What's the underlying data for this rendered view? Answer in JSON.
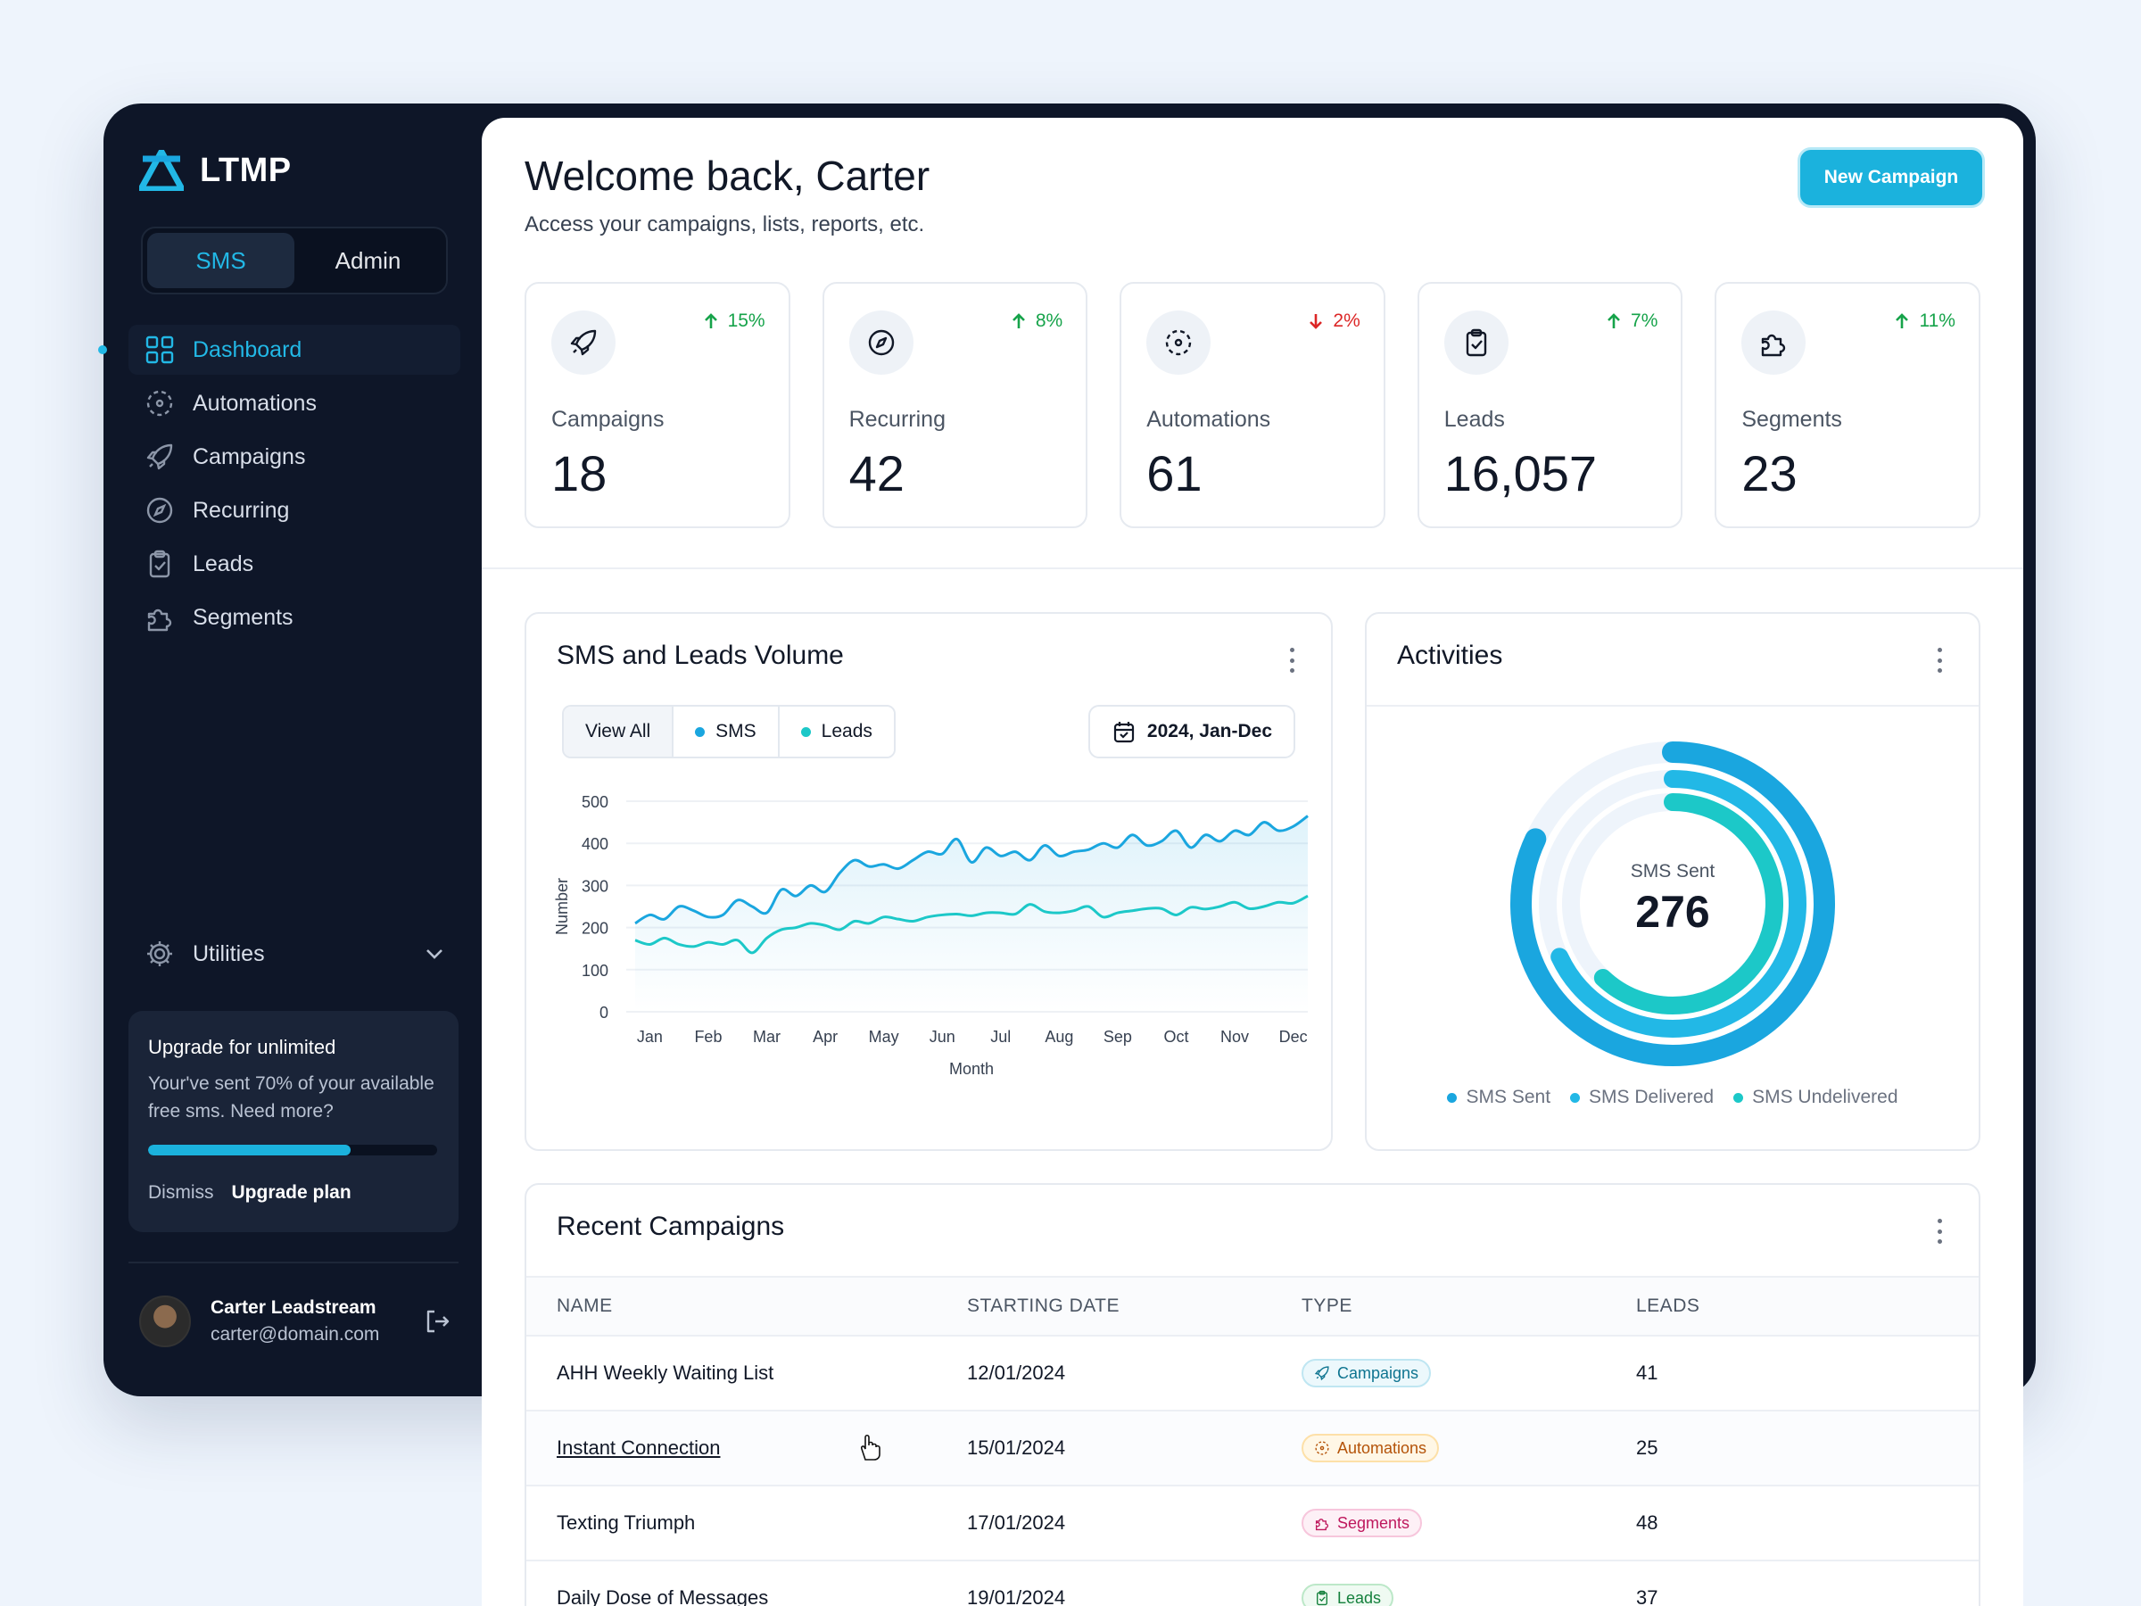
{
  "app": {
    "name": "LTMP"
  },
  "switcher": {
    "options": [
      "SMS",
      "Admin"
    ],
    "active": "SMS"
  },
  "nav": {
    "items": [
      {
        "label": "Dashboard",
        "icon": "grid-icon",
        "active": true
      },
      {
        "label": "Automations",
        "icon": "automation-icon"
      },
      {
        "label": "Campaigns",
        "icon": "rocket-icon"
      },
      {
        "label": "Recurring",
        "icon": "compass-icon"
      },
      {
        "label": "Leads",
        "icon": "clipboard-check-icon"
      },
      {
        "label": "Segments",
        "icon": "puzzle-icon"
      }
    ],
    "utilities": "Utilities"
  },
  "upgrade": {
    "title": "Upgrade for unlimited",
    "text": "Your've sent 70% of your available free sms. Need more?",
    "progress": 0.7,
    "dismiss": "Dismiss",
    "plan": "Upgrade plan"
  },
  "user": {
    "name": "Carter Leadstream",
    "email": "carter@domain.com"
  },
  "header": {
    "title": "Welcome back, Carter",
    "subtitle": "Access your campaigns, lists, reports, etc.",
    "new_campaign": "New Campaign"
  },
  "stats": [
    {
      "label": "Campaigns",
      "value": "18",
      "trend": "15%",
      "direction": "up",
      "icon": "rocket-icon"
    },
    {
      "label": "Recurring",
      "value": "42",
      "trend": "8%",
      "direction": "up",
      "icon": "compass-icon"
    },
    {
      "label": "Automations",
      "value": "61",
      "trend": "2%",
      "direction": "down",
      "icon": "automation-icon"
    },
    {
      "label": "Leads",
      "value": "16,057",
      "trend": "7%",
      "direction": "up",
      "icon": "clipboard-check-icon"
    },
    {
      "label": "Segments",
      "value": "23",
      "trend": "11%",
      "direction": "up",
      "icon": "puzzle-icon"
    }
  ],
  "volume_card": {
    "title": "SMS and Leads Volume",
    "filters": [
      "View All",
      "SMS",
      "Leads"
    ],
    "date_range": "2024, Jan-Dec"
  },
  "chart_data": {
    "type": "line",
    "title": "SMS and Leads Volume",
    "xlabel": "Month",
    "ylabel": "Number",
    "ylim": [
      0,
      500
    ],
    "yticks": [
      0,
      100,
      200,
      300,
      400,
      500
    ],
    "categories": [
      "Jan",
      "Feb",
      "Mar",
      "Apr",
      "May",
      "Jun",
      "Jul",
      "Aug",
      "Sep",
      "Oct",
      "Nov",
      "Dec"
    ],
    "x": [
      0,
      0.25,
      0.5,
      0.75,
      1,
      1.25,
      1.5,
      1.75,
      2,
      2.25,
      2.5,
      2.75,
      3,
      3.25,
      3.5,
      3.75,
      4,
      4.25,
      4.5,
      4.75,
      5,
      5.25,
      5.5,
      5.75,
      6,
      6.25,
      6.5,
      6.75,
      7,
      7.25,
      7.5,
      7.75,
      8,
      8.25,
      8.5,
      8.75,
      9,
      9.25,
      9.5,
      9.75,
      10,
      10.25,
      10.5,
      10.75,
      11,
      11.25,
      11.5
    ],
    "series": [
      {
        "name": "SMS",
        "color": "#1aa6df",
        "area": true,
        "values": [
          210,
          230,
          220,
          250,
          240,
          225,
          230,
          265,
          250,
          235,
          290,
          275,
          300,
          285,
          330,
          360,
          345,
          350,
          340,
          360,
          380,
          375,
          410,
          355,
          390,
          370,
          380,
          360,
          395,
          370,
          380,
          385,
          400,
          390,
          420,
          395,
          405,
          430,
          390,
          420,
          405,
          430,
          420,
          450,
          430,
          440,
          465
        ]
      },
      {
        "name": "Leads",
        "color": "#1cc8c8",
        "values": [
          170,
          160,
          175,
          160,
          155,
          165,
          160,
          170,
          140,
          175,
          195,
          200,
          210,
          205,
          195,
          215,
          210,
          225,
          220,
          215,
          225,
          230,
          232,
          228,
          235,
          235,
          232,
          255,
          238,
          235,
          240,
          250,
          225,
          235,
          240,
          245,
          245,
          230,
          248,
          244,
          250,
          260,
          245,
          250,
          260,
          258,
          275
        ]
      }
    ]
  },
  "activities": {
    "title": "Activities",
    "center_label": "SMS Sent",
    "center_value": "276",
    "rings": [
      {
        "name": "SMS Sent",
        "color": "#1aa6df",
        "fraction": 0.82
      },
      {
        "name": "SMS Delivered",
        "color": "#22b8e6",
        "fraction": 0.68
      },
      {
        "name": "SMS Undelivered",
        "color": "#1cc8c8",
        "fraction": 0.62
      }
    ]
  },
  "recent": {
    "title": "Recent Campaigns",
    "columns": [
      "NAME",
      "STARTING DATE",
      "TYPE",
      "LEADS"
    ],
    "rows": [
      {
        "name": "AHH Weekly Waiting List",
        "date": "12/01/2024",
        "type": "Campaigns",
        "leads": "41"
      },
      {
        "name": "Instant Connection",
        "date": "15/01/2024",
        "type": "Automations",
        "leads": "25"
      },
      {
        "name": "Texting Triumph",
        "date": "17/01/2024",
        "type": "Segments",
        "leads": "48"
      },
      {
        "name": "Daily Dose of Messages",
        "date": "19/01/2024",
        "type": "Leads",
        "leads": "37"
      }
    ]
  }
}
